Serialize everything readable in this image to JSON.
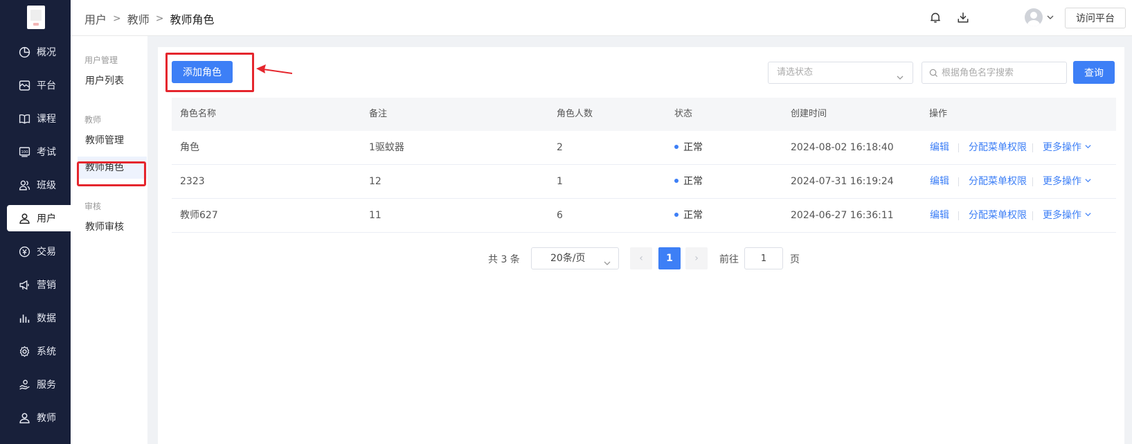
{
  "nav": {
    "items": [
      {
        "label": "概况",
        "icon": "overview-icon"
      },
      {
        "label": "平台",
        "icon": "platform-icon"
      },
      {
        "label": "课程",
        "icon": "course-icon"
      },
      {
        "label": "考试",
        "icon": "exam-icon"
      },
      {
        "label": "班级",
        "icon": "class-icon"
      },
      {
        "label": "用户",
        "icon": "user-icon"
      },
      {
        "label": "交易",
        "icon": "trade-icon"
      },
      {
        "label": "营销",
        "icon": "marketing-icon"
      },
      {
        "label": "数据",
        "icon": "data-icon"
      },
      {
        "label": "系统",
        "icon": "system-icon"
      },
      {
        "label": "服务",
        "icon": "service-icon"
      },
      {
        "label": "教师",
        "icon": "teacher-icon"
      }
    ],
    "active": "用户"
  },
  "breadcrumb": {
    "level1": "用户",
    "level2": "教师",
    "current": "教师角色"
  },
  "header": {
    "visit_label": "访问平台"
  },
  "submenu": {
    "group1": "用户管理",
    "item_user_list": "用户列表",
    "group2": "教师",
    "item_teacher_manage": "教师管理",
    "item_teacher_role": "教师角色",
    "group3": "审核",
    "item_teacher_review": "教师审核"
  },
  "toolbar": {
    "add_label": "添加角色",
    "status_placeholder": "请选状态",
    "search_placeholder": "根据角色名字搜索",
    "query_label": "查询"
  },
  "table": {
    "headers": {
      "name": "角色名称",
      "remark": "备注",
      "count": "角色人数",
      "status": "状态",
      "created": "创建时间",
      "actions": "操作"
    },
    "rows": [
      {
        "name": "角色",
        "remark": "1驱蚊器",
        "count": "2",
        "status": "正常",
        "created": "2024-08-02 16:18:40"
      },
      {
        "name": "2323",
        "remark": "12",
        "count": "1",
        "status": "正常",
        "created": "2024-07-31 16:19:24"
      },
      {
        "name": "教师627",
        "remark": "11",
        "count": "6",
        "status": "正常",
        "created": "2024-06-27 16:36:11"
      }
    ],
    "action_edit": "编辑",
    "action_assign": "分配菜单权限",
    "action_more": "更多操作"
  },
  "pagination": {
    "total": "共 3 条",
    "page_size": "20条/页",
    "current": "1",
    "goto_label": "前往",
    "goto_value": "1",
    "page_suffix": "页"
  },
  "colors": {
    "accent": "#3d7ff6",
    "nav_bg": "#18203a",
    "highlight": "#e5262d"
  }
}
